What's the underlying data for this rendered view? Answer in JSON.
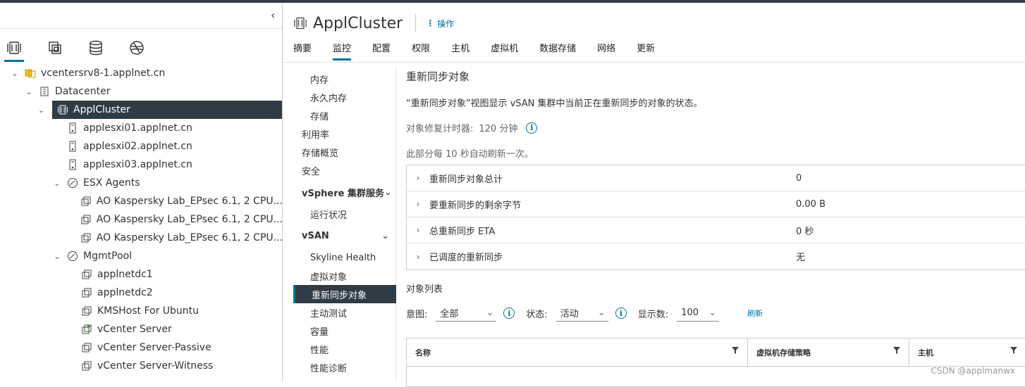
{
  "left_nav": {
    "collapse_glyph": "‹",
    "tab_icons": [
      "hosts-clusters-icon",
      "vms-templates-icon",
      "storage-icon",
      "networking-icon"
    ],
    "tree": [
      {
        "label": "vcentersrv8-1.applnet.cn",
        "icon": "vcenter-icon",
        "level": 0,
        "expanded": true
      },
      {
        "label": "Datacenter",
        "icon": "datacenter-icon",
        "level": 1,
        "expanded": true
      },
      {
        "label": "ApplCluster",
        "icon": "cluster-icon",
        "level": 2,
        "expanded": true,
        "selected": true
      },
      {
        "label": "applesxi01.applnet.cn",
        "icon": "host-icon",
        "level": 3
      },
      {
        "label": "applesxi02.applnet.cn",
        "icon": "host-icon",
        "level": 3
      },
      {
        "label": "applesxi03.applnet.cn",
        "icon": "host-icon",
        "level": 3
      },
      {
        "label": "ESX Agents",
        "icon": "resource-pool-icon",
        "level": 3,
        "expanded": true
      },
      {
        "label": "AO Kaspersky Lab_EPsec 6.1, 2 CPU...",
        "icon": "vm-icon",
        "level": 4
      },
      {
        "label": "AO Kaspersky Lab_EPsec 6.1, 2 CPU...",
        "icon": "vm-icon",
        "level": 4
      },
      {
        "label": "AO Kaspersky Lab_EPsec 6.1, 2 CPU...",
        "icon": "vm-icon",
        "level": 4
      },
      {
        "label": "MgmtPool",
        "icon": "resource-pool-icon",
        "level": 3,
        "expanded": true
      },
      {
        "label": "applnetdc1",
        "icon": "vm-icon",
        "level": 4
      },
      {
        "label": "applnetdc2",
        "icon": "vm-icon",
        "level": 4
      },
      {
        "label": "KMSHost For Ubuntu",
        "icon": "vm-icon",
        "level": 4
      },
      {
        "label": "vCenter Server",
        "icon": "vm-running-icon",
        "level": 4
      },
      {
        "label": "vCenter Server-Passive",
        "icon": "vm-icon",
        "level": 4
      },
      {
        "label": "vCenter Server-Witness",
        "icon": "vm-icon",
        "level": 4
      }
    ]
  },
  "header": {
    "title": "ApplCluster",
    "actions_label": "操作",
    "tabs": [
      "摘要",
      "监控",
      "配置",
      "权限",
      "主机",
      "虚拟机",
      "数据存储",
      "网络",
      "更新"
    ],
    "active_tab": "监控"
  },
  "subnav": {
    "items": [
      {
        "label": "内存",
        "kind": "l2"
      },
      {
        "label": "永久内存",
        "kind": "l2"
      },
      {
        "label": "存储",
        "kind": "l2"
      },
      {
        "label": "利用率",
        "kind": "l1"
      },
      {
        "label": "存储概览",
        "kind": "l1"
      },
      {
        "label": "安全",
        "kind": "l1"
      },
      {
        "label": "vSphere 集群服务",
        "kind": "grp"
      },
      {
        "label": "运行状况",
        "kind": "l2"
      },
      {
        "label": "vSAN",
        "kind": "grp"
      },
      {
        "label": "Skyline Health",
        "kind": "l2"
      },
      {
        "label": "虚拟对象",
        "kind": "l2"
      },
      {
        "label": "重新同步对象",
        "kind": "l2",
        "selected": true
      },
      {
        "label": "主动测试",
        "kind": "l2"
      },
      {
        "label": "容量",
        "kind": "l2"
      },
      {
        "label": "性能",
        "kind": "l2"
      },
      {
        "label": "性能诊断",
        "kind": "l2"
      }
    ]
  },
  "content": {
    "heading": "重新同步对象",
    "description": "“重新同步对象”视图显示 vSAN 集群中当前正在重新同步的对象的状态。",
    "timer_label": "对象修复计时器:",
    "timer_value": "120 分钟",
    "refresh_note": "此部分每 10 秒自动刷新一次。",
    "stack_rows": [
      {
        "label": "重新同步对象总计",
        "value": "0"
      },
      {
        "label": "要重新同步的剩余字节",
        "value": "0.00 B"
      },
      {
        "label": "总重新同步 ETA",
        "value": "0 秒"
      },
      {
        "label": "已调度的重新同步",
        "value": "无"
      }
    ],
    "object_list_title": "对象列表",
    "filters": {
      "intent_label": "意图:",
      "intent_value": "全部",
      "state_label": "状态:",
      "state_value": "活动",
      "show_label": "显示数:",
      "show_value": "100",
      "refresh_label": "刷新"
    },
    "grid_columns": [
      "名称",
      "虚拟机存储策略",
      "主机"
    ]
  },
  "watermark": "CSDN @applmanwx"
}
